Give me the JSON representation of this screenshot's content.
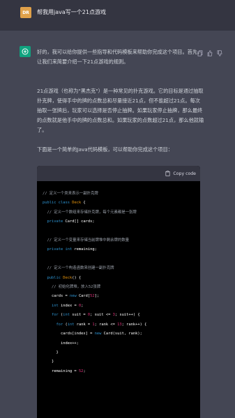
{
  "user": {
    "avatar_text": "DR",
    "message": "帮我用java写一个21点游戏"
  },
  "assistant": {
    "paragraphs": [
      "好的，我可以给你提供一些指导和代码模板来帮助你完成这个项目。首先，让我们来简要介绍一下21点游戏的规则。",
      "21点游戏（也称为\"黑杰克\"）是一种常见的扑克游戏。它的目标是通过抽取扑克牌，使得手中的牌的点数总和尽量接近21点，但不能超过21点。每次抽取一张牌后，玩家可以选择是否停止抽牌。如果玩家停止抽牌，那么最终的点数就是他手中的牌的点数总和。如果玩家的点数超过21点，那么他就输了。",
      "下面是一个简单的Java代码模板，可以帮助你完成这个项目："
    ],
    "copy_label": "Copy code",
    "code_lines": [
      {
        "parts": [
          {
            "c": "cmt",
            "t": "// 定义一个类来表示一副扑克牌"
          }
        ]
      },
      {
        "parts": [
          {
            "c": "kw",
            "t": "public class "
          },
          {
            "c": "ty",
            "t": "Deck"
          },
          {
            "c": "",
            "t": " {"
          }
        ]
      },
      {
        "parts": [
          {
            "c": "cmt",
            "t": "  // 定义一个数组来存储扑克牌，每个元素都是一张牌"
          }
        ]
      },
      {
        "parts": [
          {
            "c": "kw",
            "t": "  private "
          },
          {
            "c": "",
            "t": "Card[] cards;"
          }
        ]
      },
      {
        "parts": [
          {
            "c": "",
            "t": ""
          }
        ]
      },
      {
        "parts": [
          {
            "c": "cmt",
            "t": "  // 定义一个变量来存储当前牌堆中剩余牌的数量"
          }
        ]
      },
      {
        "parts": [
          {
            "c": "kw",
            "t": "  private int "
          },
          {
            "c": "",
            "t": "remaining;"
          }
        ]
      },
      {
        "parts": [
          {
            "c": "",
            "t": ""
          }
        ]
      },
      {
        "parts": [
          {
            "c": "cmt",
            "t": "  // 定义一个构造函数来创建一副扑克牌"
          }
        ]
      },
      {
        "parts": [
          {
            "c": "kw",
            "t": "  public "
          },
          {
            "c": "ty",
            "t": "Deck"
          },
          {
            "c": "",
            "t": "() {"
          }
        ]
      },
      {
        "parts": [
          {
            "c": "cmt",
            "t": "    // 初始化牌堆，放入52张牌"
          }
        ]
      },
      {
        "parts": [
          {
            "c": "",
            "t": "    cards = "
          },
          {
            "c": "kw",
            "t": "new "
          },
          {
            "c": "",
            "t": "Card["
          },
          {
            "c": "num",
            "t": "52"
          },
          {
            "c": "",
            "t": "];"
          }
        ]
      },
      {
        "parts": [
          {
            "c": "kw",
            "t": "    int "
          },
          {
            "c": "",
            "t": "index = "
          },
          {
            "c": "num",
            "t": "0"
          },
          {
            "c": "",
            "t": ";"
          }
        ]
      },
      {
        "parts": [
          {
            "c": "kw",
            "t": "    for "
          },
          {
            "c": "",
            "t": "("
          },
          {
            "c": "kw",
            "t": "int "
          },
          {
            "c": "",
            "t": "suit = "
          },
          {
            "c": "num",
            "t": "0"
          },
          {
            "c": "",
            "t": "; suit <= "
          },
          {
            "c": "num",
            "t": "3"
          },
          {
            "c": "",
            "t": "; suit++) {"
          }
        ]
      },
      {
        "parts": [
          {
            "c": "kw",
            "t": "      for "
          },
          {
            "c": "",
            "t": "("
          },
          {
            "c": "kw",
            "t": "int "
          },
          {
            "c": "",
            "t": "rank = "
          },
          {
            "c": "num",
            "t": "1"
          },
          {
            "c": "",
            "t": "; rank <= "
          },
          {
            "c": "num",
            "t": "13"
          },
          {
            "c": "",
            "t": "; rank++) {"
          }
        ]
      },
      {
        "parts": [
          {
            "c": "",
            "t": "        cards[index] = "
          },
          {
            "c": "kw",
            "t": "new "
          },
          {
            "c": "",
            "t": "Card(suit, rank);"
          }
        ]
      },
      {
        "parts": [
          {
            "c": "",
            "t": "        index++;"
          }
        ]
      },
      {
        "parts": [
          {
            "c": "",
            "t": "      }"
          }
        ]
      },
      {
        "parts": [
          {
            "c": "",
            "t": "    }"
          }
        ]
      },
      {
        "parts": [
          {
            "c": "",
            "t": "    remaining = "
          },
          {
            "c": "num",
            "t": "52"
          },
          {
            "c": "",
            "t": ";"
          }
        ]
      }
    ]
  }
}
